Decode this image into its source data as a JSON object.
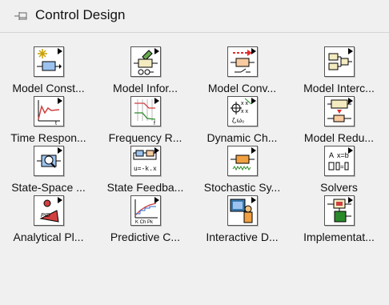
{
  "palette": {
    "title": "Control Design",
    "items": [
      {
        "label": "Model Const...",
        "icon": "model-construction-icon"
      },
      {
        "label": "Model Infor...",
        "icon": "model-information-icon"
      },
      {
        "label": "Model Conv...",
        "icon": "model-conversion-icon"
      },
      {
        "label": "Model Interc...",
        "icon": "model-interconnection-icon"
      },
      {
        "label": "Time Respon...",
        "icon": "time-response-icon"
      },
      {
        "label": "Frequency R...",
        "icon": "frequency-response-icon"
      },
      {
        "label": "Dynamic Ch...",
        "icon": "dynamic-characteristics-icon"
      },
      {
        "label": "Model Redu...",
        "icon": "model-reduction-icon"
      },
      {
        "label": "State-Space ...",
        "icon": "state-space-model-analysis-icon"
      },
      {
        "label": "State Feedba...",
        "icon": "state-feedback-design-icon"
      },
      {
        "label": "Stochastic Sy...",
        "icon": "stochastic-systems-icon"
      },
      {
        "label": "Solvers",
        "icon": "solvers-icon"
      },
      {
        "label": "Analytical Pl...",
        "icon": "analytical-pid-design-icon"
      },
      {
        "label": "Predictive C...",
        "icon": "predictive-control-icon"
      },
      {
        "label": "Interactive D...",
        "icon": "interactive-design-icon"
      },
      {
        "label": "Implementat...",
        "icon": "implementation-icon"
      }
    ]
  }
}
